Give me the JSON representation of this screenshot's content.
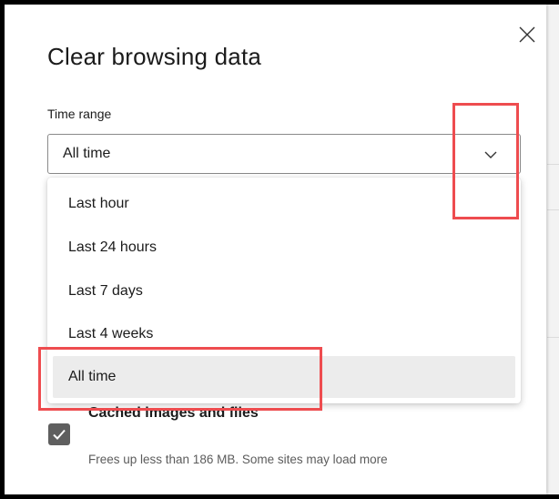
{
  "dialog": {
    "title": "Clear browsing data",
    "time_range_label": "Time range",
    "selected_range": "All time",
    "options": [
      {
        "label": "Last hour",
        "selected": false
      },
      {
        "label": "Last 24 hours",
        "selected": false
      },
      {
        "label": "Last 7 days",
        "selected": false
      },
      {
        "label": "Last 4 weeks",
        "selected": false
      },
      {
        "label": "All time",
        "selected": true
      }
    ],
    "cached_item": {
      "label": "Cached images and files",
      "description": "Frees up less than 186 MB. Some sites may load more",
      "checked": true
    }
  },
  "colors": {
    "checkbox": "#5f5f5f",
    "highlight": "#ee4c4f",
    "selected_option_bg": "#ececec"
  },
  "icons": {
    "close": "close-icon",
    "dropdown": "chevron-down-icon",
    "check": "checkmark-icon"
  }
}
